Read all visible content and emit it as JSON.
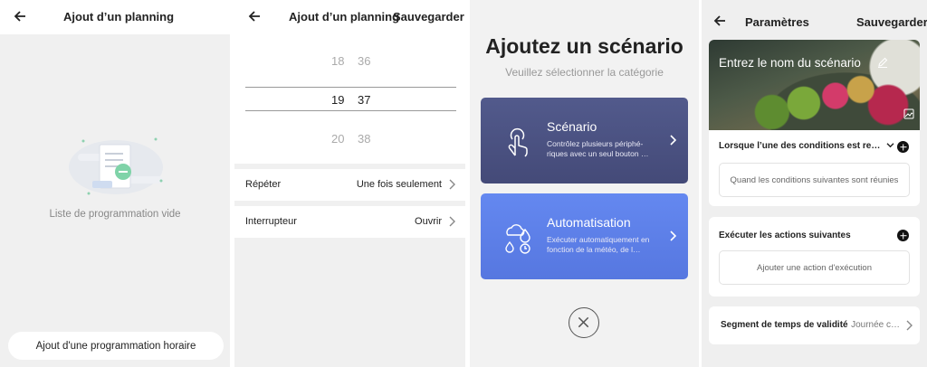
{
  "screen1": {
    "title": "Ajout d’un planning",
    "empty_text": "Liste de programmation vide",
    "add_button": "Ajout d'une programmation horaire",
    "icons": [
      "back-arrow-icon",
      "empty-list-illustration"
    ]
  },
  "screen2": {
    "title": "Ajout d’un planning",
    "save": "Sauvegarder",
    "picker": {
      "hours": [
        "18",
        "19",
        "20"
      ],
      "minutes": [
        "36",
        "37",
        "38"
      ],
      "selected": {
        "hour": "19",
        "minute": "37"
      }
    },
    "rows": [
      {
        "label": "Répéter",
        "value": "Une fois seulement"
      },
      {
        "label": "Interrupteur",
        "value": "Ouvrir"
      }
    ]
  },
  "screen3": {
    "title": "Ajoutez un scénario",
    "subtitle": "Veuillez sélectionner la catégorie",
    "cards": [
      {
        "title": "Scénario",
        "desc": "Contrôlez plusieurs périphé-riques avec un seul bouton …",
        "color": "#4a5080",
        "icon": "hand-tap-icon"
      },
      {
        "title": "Automatisation",
        "desc": "Exécuter automatiquement en fonction de la météo, de l…",
        "color": "#5b7fe8",
        "icon": "weather-icon"
      }
    ]
  },
  "screen4": {
    "title": "Paramètres",
    "save": "Sauvegarder",
    "name_placeholder": "Entrez le nom du scénario",
    "conditions": {
      "title": "Lorsque l’une des conditions est re…",
      "box": "Quand les conditions suivantes sont réunies"
    },
    "actions": {
      "title": "Exécuter les actions suivantes",
      "box": "Ajouter une action d'exécution"
    },
    "validity": {
      "label": "Segment de temps de validité",
      "value": "Journée c…"
    }
  }
}
